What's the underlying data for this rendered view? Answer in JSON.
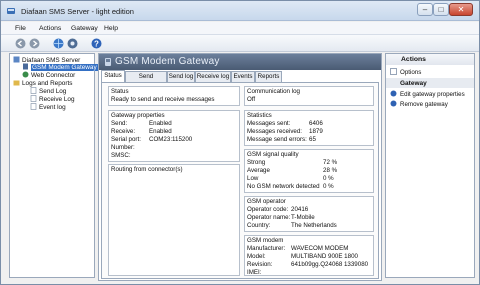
{
  "window": {
    "title": "Diafaan SMS Server - light edition"
  },
  "menu": [
    "File",
    "Actions",
    "Gateway",
    "Help"
  ],
  "tree": {
    "items": [
      "Diafaan SMS Server",
      "GSM Modem Gateway",
      "Web Connector",
      "Logs and Reports",
      "Send Log",
      "Receive Log",
      "Event log"
    ]
  },
  "header": {
    "title": "GSM Modem Gateway"
  },
  "tabs": [
    "Status",
    "Send Message",
    "Send log",
    "Receive log",
    "Events",
    "Reports"
  ],
  "status": {
    "title": "Status",
    "text": "Ready to send and receive messages"
  },
  "comm_log": {
    "title": "Communication log",
    "value": "Off"
  },
  "gateway_properties": {
    "title": "Gateway properties",
    "rows": [
      {
        "label": "Send:",
        "value": "Enabled"
      },
      {
        "label": "Receive:",
        "value": "Enabled"
      },
      {
        "label": "Serial port:",
        "value": "COM23:115200"
      },
      {
        "label": "Number:",
        "value": ""
      },
      {
        "label": "SMSC:",
        "value": ""
      }
    ]
  },
  "routing": {
    "title": "Routing from connector(s)"
  },
  "statistics": {
    "title": "Statistics",
    "rows": [
      {
        "label": "Messages sent:",
        "value": "6406"
      },
      {
        "label": "Messages received:",
        "value": "1879"
      },
      {
        "label": "Message send errors:",
        "value": "65"
      }
    ]
  },
  "signal_quality": {
    "title": "GSM signal quality",
    "rows": [
      {
        "label": "Strong",
        "value": "72 %"
      },
      {
        "label": "Average",
        "value": "28 %"
      },
      {
        "label": "Low",
        "value": "0 %"
      },
      {
        "label": "No GSM network detected",
        "value": "0 %"
      }
    ]
  },
  "operator": {
    "title": "GSM operator",
    "rows": [
      {
        "label": "Operator code:",
        "value": "20416"
      },
      {
        "label": "Operator name:",
        "value": "T-Mobile"
      },
      {
        "label": "Country:",
        "value": "The Netherlands"
      }
    ]
  },
  "modem": {
    "title": "GSM modem",
    "rows": [
      {
        "label": "Manufacturer:",
        "value": "WAVECOM MODEM"
      },
      {
        "label": "Model:",
        "value": "MULTIBAND  900E  1800"
      },
      {
        "label": "Revision:",
        "value": "641b09gg.Q24068 1339080"
      },
      {
        "label": "IMEI:",
        "value": ""
      }
    ]
  },
  "actions_panel": {
    "title": "Actions",
    "options_label": "Options",
    "gateway_section": "Gateway",
    "items": [
      "Edit gateway properties",
      "Remove gateway"
    ]
  }
}
